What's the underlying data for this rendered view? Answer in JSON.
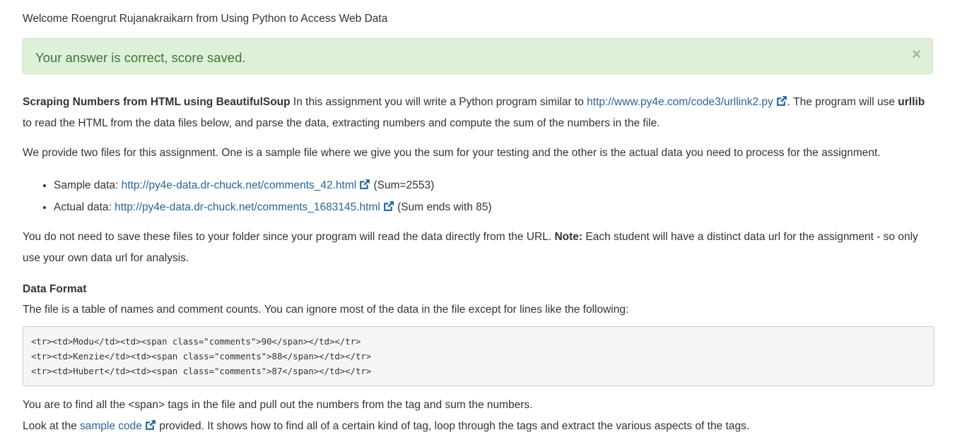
{
  "header": {
    "welcome": "Welcome Roengrut Rujanakraikarn from Using Python to Access Web Data"
  },
  "alert": {
    "message": "Your answer is correct, score saved.",
    "close_symbol": "×"
  },
  "intro": {
    "title": "Scraping Numbers from HTML using BeautifulSoup",
    "text1": " In this assignment you will write a Python program similar to ",
    "link": "http://www.py4e.com/code3/urllink2.py",
    "text2": ". The program will use ",
    "bold2": "urllib",
    "text3": " to read the HTML from the data files below, and parse the data, extracting numbers and compute the sum of the numbers in the file."
  },
  "provide": {
    "text": "We provide two files for this assignment. One is a sample file where we give you the sum for your testing and the other is the actual data you need to process for the assignment."
  },
  "files": [
    {
      "label": "Sample data: ",
      "url": "http://py4e-data.dr-chuck.net/comments_42.html",
      "note": " (Sum=2553)"
    },
    {
      "label": "Actual data: ",
      "url": "http://py4e-data.dr-chuck.net/comments_1683145.html",
      "note": " (Sum ends with 85)"
    }
  ],
  "note_para": {
    "text1": "You do not need to save these files to your folder since your program will read the data directly from the URL. ",
    "bold": "Note:",
    "text2": " Each student will have a distinct data url for the assignment - so only use your own data url for analysis."
  },
  "format": {
    "heading": "Data Format",
    "text": "The file is a table of names and comment counts. You can ignore most of the data in the file except for lines like the following:",
    "code": "<tr><td>Modu</td><td><span class=\"comments\">90</span></td></tr>\n<tr><td>Kenzie</td><td><span class=\"comments\">88</span></td></tr>\n<tr><td>Hubert</td><td><span class=\"comments\">87</span></td></tr>"
  },
  "span_para": {
    "text": "You are to find all the <span> tags in the file and pull out the numbers from the tag and sum the numbers."
  },
  "look_para": {
    "text1": "Look at the ",
    "link": "sample code",
    "text2": " provided. It shows how to find all of a certain kind of tag, loop through the tags and extract the various aspects of the tags."
  },
  "icons": {
    "external_link": "external-link-icon",
    "close": "close-icon"
  },
  "colors": {
    "link": "#2a6496",
    "alert_bg": "#dff0d8",
    "alert_text": "#3c763d"
  }
}
